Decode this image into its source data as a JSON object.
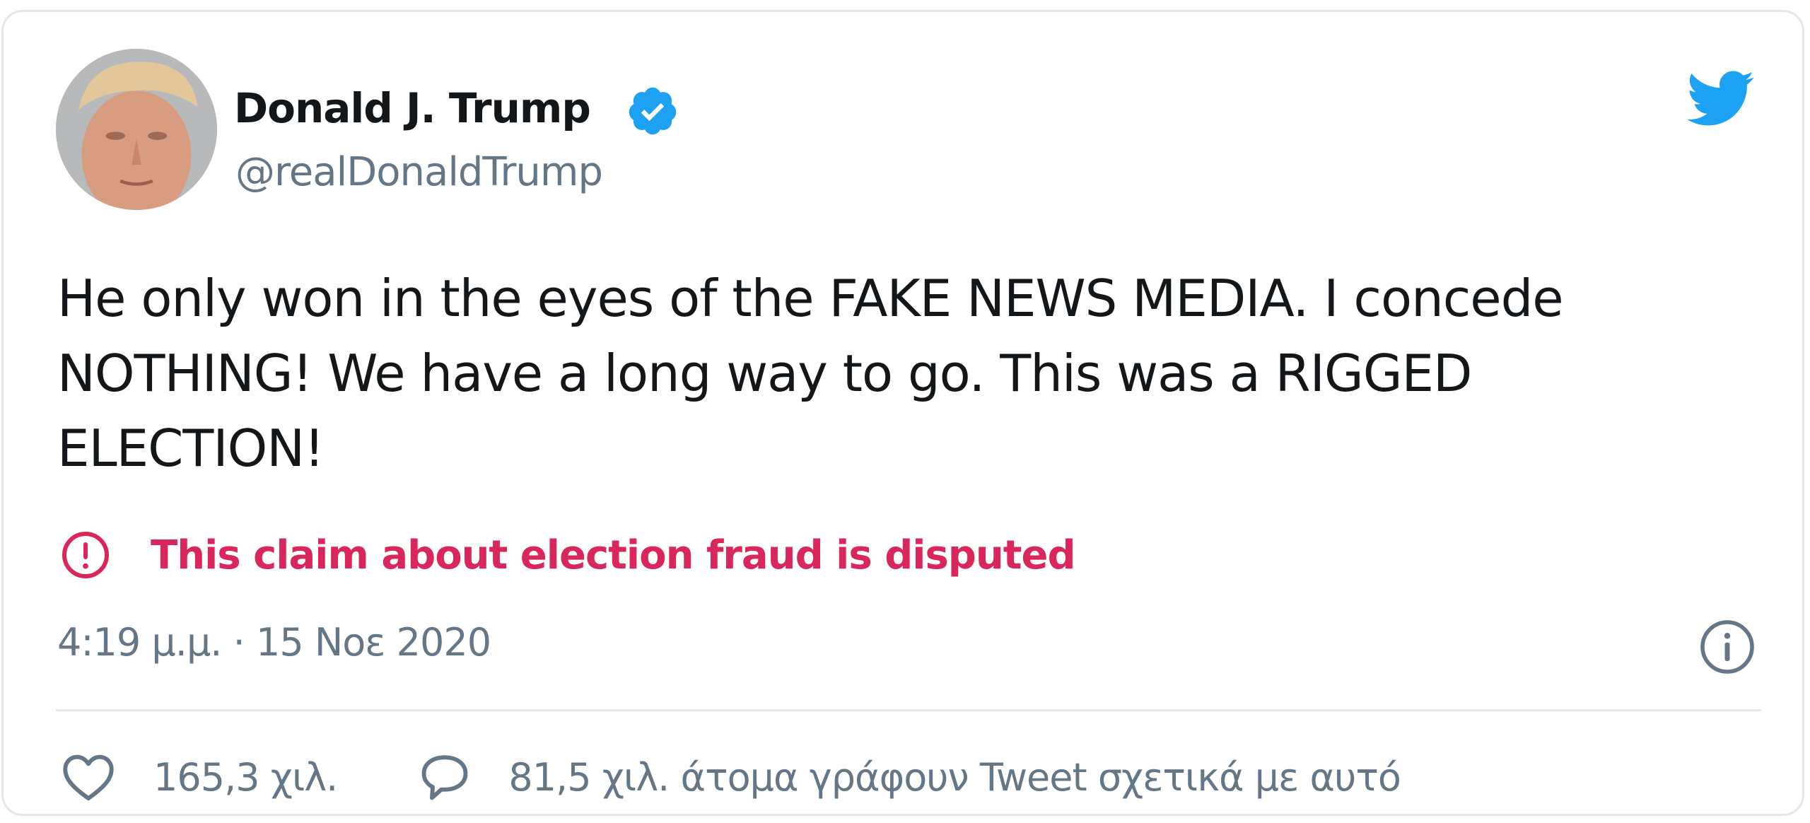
{
  "author": {
    "display_name": "Donald J. Trump",
    "handle": "@realDonaldTrump",
    "verified": true
  },
  "tweet": {
    "text_lines": [
      "He only won in the eyes of the FAKE NEWS MEDIA. I concede",
      "NOTHING! We have a long way to go. This was a RIGGED",
      "ELECTION!"
    ],
    "warning_label": "This claim about election fraud is disputed",
    "timestamp": "4:19 μ.μ. · 15 Νοε 2020"
  },
  "actions": {
    "like_count": "165,3 χιλ.",
    "reply_text": "81,5 χιλ. άτομα γράφουν Tweet σχετικά με αυτό"
  },
  "icons": {
    "verified": "verified-badge-icon",
    "brand": "twitter-bird-icon",
    "warning": "exclamation-circle-icon",
    "info": "info-circle-icon",
    "like": "heart-icon",
    "reply": "speech-bubble-icon"
  },
  "colors": {
    "text_primary": "#14171a",
    "text_secondary": "#657786",
    "brand_blue": "#1da1f2",
    "warning_pink": "#d9265d",
    "border": "#e1e8ed"
  }
}
